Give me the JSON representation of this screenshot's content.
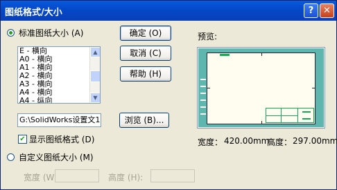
{
  "window": {
    "title": "图纸格式/大小",
    "help_icon": "?",
    "close_icon": "✕"
  },
  "standard": {
    "label": "标准图纸大小 (A)",
    "selected": true
  },
  "paper_sizes": [
    "E - 横向",
    "A0 - 横向",
    "A1 - 横向",
    "A2 - 横向",
    "A3 - 横向",
    "A4 - 横向",
    "A4 - 纵向"
  ],
  "path_value": "G:\\SolidWorks设置文1",
  "browse_label": "浏览 (B)...",
  "show_format": {
    "label": "显示图纸格式 (D)",
    "checked": true
  },
  "custom": {
    "label": "自定义图纸大小 (M)",
    "selected": false
  },
  "custom_width_label": "宽度 (W):",
  "custom_height_label": "高度 (H):",
  "buttons": {
    "ok": "确定 (O)",
    "cancel": "取消 (C)",
    "help": "帮助 (H)"
  },
  "preview": {
    "label": "预览:",
    "width_label": "宽度：",
    "width_value": "420.00mm",
    "height_label": "高度：",
    "height_value": "297.00mm"
  },
  "colors": {
    "titlebar": "#0348C8",
    "dialog_bg": "#ECE9D8",
    "preview_bg": "#5EB6AE",
    "sheet_bg": "#FFFDF0"
  }
}
